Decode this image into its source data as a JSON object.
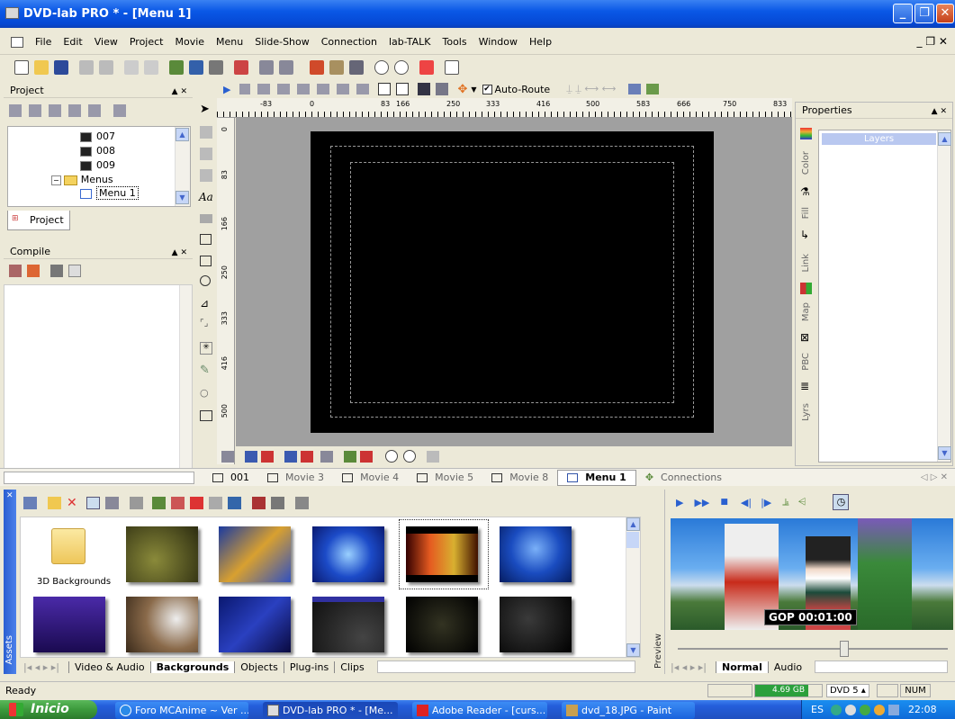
{
  "window": {
    "title": "DVD-lab PRO * - [Menu 1]"
  },
  "menu": [
    "File",
    "Edit",
    "View",
    "Project",
    "Movie",
    "Menu",
    "Slide-Show",
    "Connection",
    "lab-TALK",
    "Tools",
    "Window",
    "Help"
  ],
  "toolbar2": {
    "auto_route": "Auto-Route"
  },
  "project_panel": {
    "title": "Project",
    "items": [
      "007",
      "008",
      "009",
      "Menus",
      "Menu 1"
    ],
    "tab": "Project"
  },
  "compile_panel": {
    "title": "Compile"
  },
  "ruler": {
    "h_ticks": [
      "-83",
      "0",
      "83",
      "166",
      "250",
      "333",
      "416",
      "500",
      "583",
      "666",
      "750",
      "833"
    ],
    "v_ticks": [
      "0",
      "83",
      "166",
      "250",
      "333",
      "416",
      "500"
    ]
  },
  "doc_tabs": [
    "001",
    "Movie 3",
    "Movie 4",
    "Movie 5",
    "Movie 8",
    "Menu 1",
    "Connections"
  ],
  "properties": {
    "title": "Properties",
    "layers": "Layers",
    "side_tabs": [
      "Color",
      "Fill",
      "Link",
      "Map",
      "PBC",
      "Lyrs"
    ]
  },
  "assets": {
    "side_label": "Assets",
    "first_item": "3D Backgrounds",
    "tabs": [
      "Video & Audio",
      "Backgrounds",
      "Objects",
      "Plug-ins",
      "Clips"
    ],
    "active_tab": "Backgrounds"
  },
  "preview": {
    "side_label": "Preview",
    "gop": "GOP 00:01:00",
    "tabs": [
      "Normal",
      "Audio"
    ]
  },
  "status": {
    "text": "Ready",
    "size": "4.69 GB",
    "disc": "DVD 5",
    "num": "NUM"
  },
  "taskbar": {
    "start": "Inicio",
    "tasks": [
      "Foro MCAnime ~ Ver ...",
      "DVD-lab PRO * - [Me...",
      "Adobe Reader - [curs...",
      "dvd_18.JPG - Paint"
    ],
    "lang": "ES",
    "clock": "22:08"
  },
  "colors": {
    "titlebar": "#0a58e6",
    "taskbar": "#245edb",
    "start": "#3c9a3c",
    "canvas_bg": "#000000"
  }
}
